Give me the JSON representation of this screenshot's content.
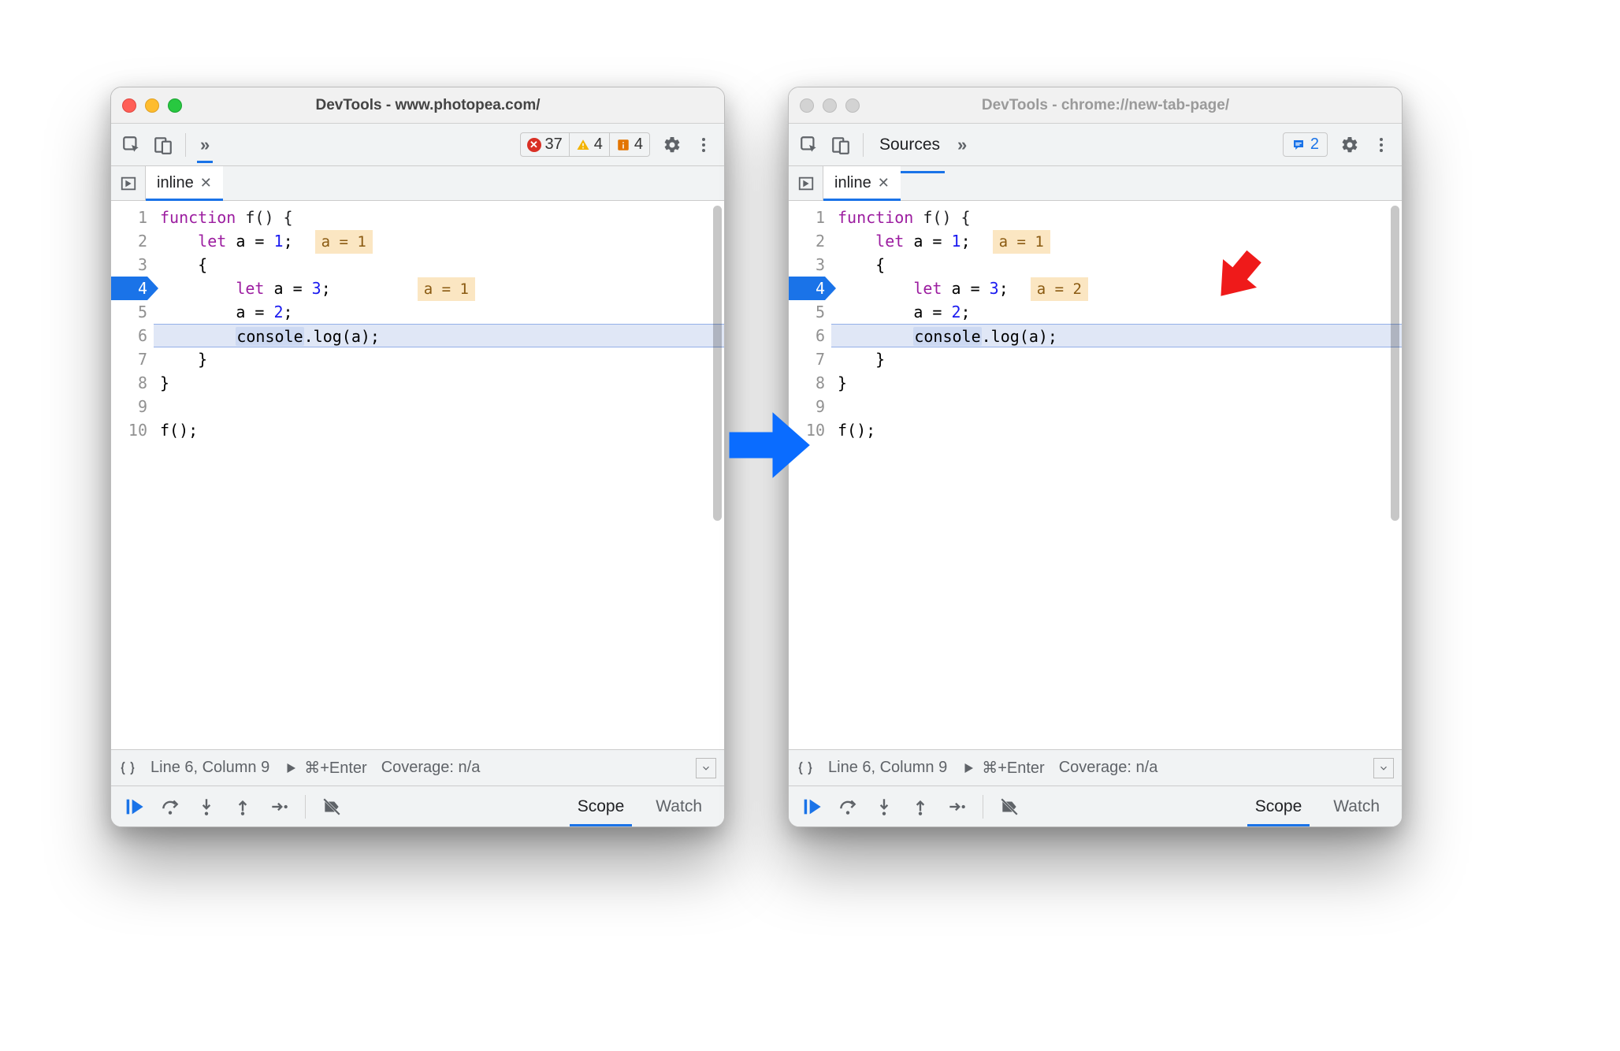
{
  "left": {
    "title": "DevTools - www.photopea.com/",
    "active": true,
    "toolbar": {
      "errors": "37",
      "warnings": "4",
      "info": "4"
    },
    "tab": {
      "name": "inline"
    },
    "code": {
      "lines": [
        "1",
        "2",
        "3",
        "4",
        "5",
        "6",
        "7",
        "8",
        "9",
        "10"
      ],
      "exec_line": 4,
      "highlight_line": 6,
      "src": {
        "l1": "function f() {",
        "l2_kw": "let",
        "l2_rest": " a = ",
        "l2_num": "1",
        "l2_tail": ";",
        "l2_inline": "a = 1",
        "l3": "{",
        "l4_kw": "let",
        "l4_rest": " a = ",
        "l4_num": "3",
        "l4_tail": ";",
        "l4_inline": "a = 1",
        "l5_a": "a = ",
        "l5_num": "2",
        "l5_tail": ";",
        "l6_obj": "console",
        "l6_rest": ".log(a);",
        "l7": "}",
        "l8": "}",
        "l10": "f();"
      }
    },
    "status": {
      "pos": "Line 6, Column 9",
      "run": "⌘+Enter",
      "coverage": "Coverage: n/a"
    },
    "debug_tabs": {
      "scope": "Scope",
      "watch": "Watch"
    }
  },
  "right": {
    "title": "DevTools - chrome://new-tab-page/",
    "active": false,
    "toolbar": {
      "sources_label": "Sources",
      "messages": "2"
    },
    "tab": {
      "name": "inline"
    },
    "code": {
      "lines": [
        "1",
        "2",
        "3",
        "4",
        "5",
        "6",
        "7",
        "8",
        "9",
        "10"
      ],
      "exec_line": 4,
      "highlight_line": 6,
      "src": {
        "l1": "function f() {",
        "l2_kw": "let",
        "l2_rest": " a = ",
        "l2_num": "1",
        "l2_tail": ";",
        "l2_inline": "a = 1",
        "l3": "{",
        "l4_kw": "let",
        "l4_rest": " a = ",
        "l4_num": "3",
        "l4_tail": ";",
        "l4_inline": "a = 2",
        "l5_a": "a = ",
        "l5_num": "2",
        "l5_tail": ";",
        "l6_obj": "console",
        "l6_rest": ".log(a);",
        "l7": "}",
        "l8": "}",
        "l10": "f();"
      }
    },
    "status": {
      "pos": "Line 6, Column 9",
      "run": "⌘+Enter",
      "coverage": "Coverage: n/a"
    },
    "debug_tabs": {
      "scope": "Scope",
      "watch": "Watch"
    }
  }
}
